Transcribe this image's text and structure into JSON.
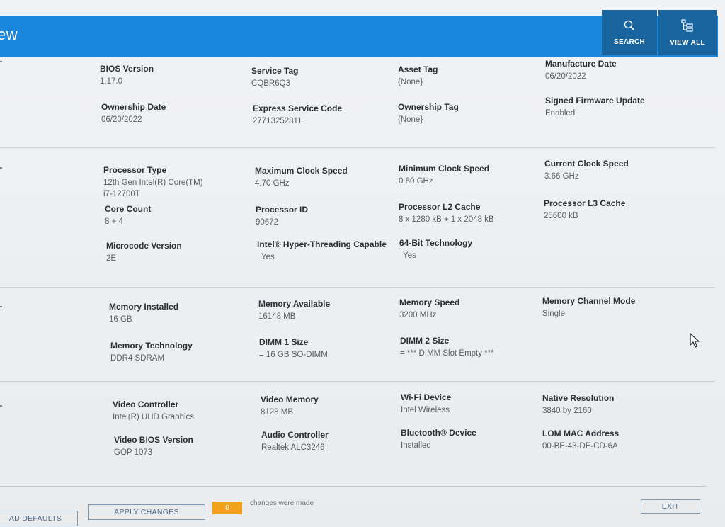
{
  "header": {
    "title": "ew",
    "search_label": "SEARCH",
    "viewall_label": "VIEW ALL",
    "accent": "#1a86dc"
  },
  "system": {
    "bios_version": {
      "label": "BIOS Version",
      "value": "1.17.0"
    },
    "service_tag": {
      "label": "Service Tag",
      "value": "CQBR6Q3"
    },
    "asset_tag": {
      "label": "Asset Tag",
      "value": "{None}"
    },
    "manufacture_date": {
      "label": "Manufacture Date",
      "value": "06/20/2022"
    },
    "ownership_date": {
      "label": "Ownership Date",
      "value": "06/20/2022"
    },
    "express_service_code": {
      "label": "Express Service Code",
      "value": "27713252811"
    },
    "ownership_tag": {
      "label": "Ownership Tag",
      "value": "{None}"
    },
    "signed_firmware_update": {
      "label": "Signed Firmware Update",
      "value": "Enabled"
    }
  },
  "processor": {
    "type": {
      "label": "Processor Type",
      "value1": "12th Gen Intel(R) Core(TM)",
      "value2": "i7-12700T"
    },
    "max_clock": {
      "label": "Maximum Clock Speed",
      "value": "4.70 GHz"
    },
    "min_clock": {
      "label": "Minimum Clock Speed",
      "value": "0.80 GHz"
    },
    "current_clock": {
      "label": "Current Clock Speed",
      "value": "3.66 GHz"
    },
    "core_count": {
      "label": "Core Count",
      "value": "8 + 4"
    },
    "processor_id": {
      "label": "Processor ID",
      "value": "90672"
    },
    "l2_cache": {
      "label": "Processor L2 Cache",
      "value": "8 x 1280  kB + 1 x 2048  kB"
    },
    "l3_cache": {
      "label": "Processor L3 Cache",
      "value": "25600 kB"
    },
    "microcode": {
      "label": "Microcode Version",
      "value": "2E"
    },
    "hyperthreading": {
      "label": "Intel® Hyper-Threading Capable",
      "value": "Yes"
    },
    "bit64": {
      "label": "64-Bit Technology",
      "value": "Yes"
    }
  },
  "memory": {
    "installed": {
      "label": "Memory Installed",
      "value": "16 GB"
    },
    "available": {
      "label": "Memory Available",
      "value": "16148 MB"
    },
    "speed": {
      "label": "Memory Speed",
      "value": "3200 MHz"
    },
    "channel_mode": {
      "label": "Memory Channel Mode",
      "value": "Single"
    },
    "technology": {
      "label": "Memory Technology",
      "value": "DDR4 SDRAM"
    },
    "dimm1": {
      "label": "DIMM 1 Size",
      "value": "= 16 GB SO-DIMM"
    },
    "dimm2": {
      "label": "DIMM 2 Size",
      "value": "= *** DIMM Slot Empty ***"
    }
  },
  "devices": {
    "video_controller": {
      "label": "Video Controller",
      "value": "Intel(R) UHD Graphics"
    },
    "video_memory": {
      "label": "Video Memory",
      "value": "8128 MB"
    },
    "wifi": {
      "label": "Wi-Fi Device",
      "value": "Intel Wireless"
    },
    "native_resolution": {
      "label": "Native Resolution",
      "value": "3840 by 2160"
    },
    "video_bios": {
      "label": "Video BIOS Version",
      "value": "GOP 1073"
    },
    "audio": {
      "label": "Audio Controller",
      "value": "Realtek ALC3246"
    },
    "bluetooth": {
      "label": "Bluetooth® Device",
      "value": "Installed"
    },
    "lom_mac": {
      "label": "LOM MAC Address",
      "value": "00-BE-43-DE-CD-6A"
    }
  },
  "footer": {
    "load_defaults_label": "AD DEFAULTS",
    "apply_changes_label": "APPLY CHANGES",
    "changes_count": "0",
    "changes_text": "changes were made",
    "exit_label": "EXIT",
    "changes_color": "#f2a11b"
  }
}
